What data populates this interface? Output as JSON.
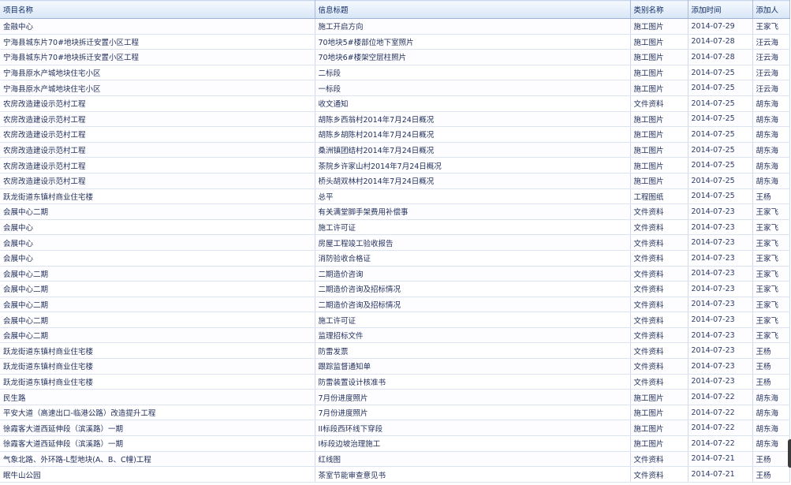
{
  "columns": [
    "项目名称",
    "信息标题",
    "类别名称",
    "添加时间",
    "添加人"
  ],
  "rows": [
    [
      "金融中心",
      "施工开启方向",
      "施工图片",
      "2014-07-29",
      "王家飞"
    ],
    [
      "宁海县城东片70#地块拆迁安置小区工程",
      "70地块5#楼部位地下室照片",
      "施工图片",
      "2014-07-28",
      "汪云海"
    ],
    [
      "宁海县城东片70#地块拆迁安置小区工程",
      "70地块6#楼架空层柱照片",
      "施工图片",
      "2014-07-28",
      "汪云海"
    ],
    [
      "宁海县原水产城地块住宅小区",
      "二标段",
      "施工图片",
      "2014-07-25",
      "汪云海"
    ],
    [
      "宁海县原水产城地块住宅小区",
      "一标段",
      "施工图片",
      "2014-07-25",
      "汪云海"
    ],
    [
      "农房改造建设示范村工程",
      "收文通知",
      "文件资料",
      "2014-07-25",
      "胡东海"
    ],
    [
      "农房改造建设示范村工程",
      "胡陈乡西翁村2014年7月24日概况",
      "施工图片",
      "2014-07-25",
      "胡东海"
    ],
    [
      "农房改造建设示范村工程",
      "胡陈乡胡陈村2014年7月24日概况",
      "施工图片",
      "2014-07-25",
      "胡东海"
    ],
    [
      "农房改造建设示范村工程",
      "桑洲镇团结村2014年7月24日概况",
      "施工图片",
      "2014-07-25",
      "胡东海"
    ],
    [
      "农房改造建设示范村工程",
      "茶院乡许家山村2014年7月24日概况",
      "施工图片",
      "2014-07-25",
      "胡东海"
    ],
    [
      "农房改造建设示范村工程",
      "桥头胡双林村2014年7月24日概况",
      "施工图片",
      "2014-07-25",
      "胡东海"
    ],
    [
      "跃龙街道东镇村商业住宅楼",
      "总平",
      "工程图纸",
      "2014-07-25",
      "王杨"
    ],
    [
      "会展中心二期",
      "有关满堂脚手架费用补偿事",
      "文件资料",
      "2014-07-23",
      "王家飞"
    ],
    [
      "会展中心",
      "施工许可证",
      "文件资料",
      "2014-07-23",
      "王家飞"
    ],
    [
      "会展中心",
      "房屋工程竣工验收报告",
      "文件资料",
      "2014-07-23",
      "王家飞"
    ],
    [
      "会展中心",
      "消防验收合格证",
      "文件资料",
      "2014-07-23",
      "王家飞"
    ],
    [
      "会展中心二期",
      "二期造价咨询",
      "文件资料",
      "2014-07-23",
      "王家飞"
    ],
    [
      "会展中心二期",
      "二期造价咨询及招标情况",
      "文件资料",
      "2014-07-23",
      "王家飞"
    ],
    [
      "会展中心二期",
      "二期造价咨询及招标情况",
      "文件资料",
      "2014-07-23",
      "王家飞"
    ],
    [
      "会展中心二期",
      "施工许可证",
      "文件资料",
      "2014-07-23",
      "王家飞"
    ],
    [
      "会展中心二期",
      "监理招标文件",
      "文件资料",
      "2014-07-23",
      "王家飞"
    ],
    [
      "跃龙街道东镇村商业住宅楼",
      "防雷发票",
      "文件资料",
      "2014-07-23",
      "王杨"
    ],
    [
      "跃龙街道东镇村商业住宅楼",
      "跟踪监督通知单",
      "文件资料",
      "2014-07-23",
      "王杨"
    ],
    [
      "跃龙街道东镇村商业住宅楼",
      "防雷装置设计核准书",
      "文件资料",
      "2014-07-23",
      "王杨"
    ],
    [
      "民生路",
      "7月份进度照片",
      "施工图片",
      "2014-07-22",
      "胡东海"
    ],
    [
      "平安大道（高速出口-临港公路）改造提升工程",
      "7月份进度照片",
      "施工图片",
      "2014-07-22",
      "胡东海"
    ],
    [
      "徐霞客大道西延伸段（滨溪路）一期",
      "II标段西环线下穿段",
      "施工图片",
      "2014-07-22",
      "胡东海"
    ],
    [
      "徐霞客大道西延伸段（滨溪路）一期",
      "I标段边坡治理施工",
      "施工图片",
      "2014-07-22",
      "胡东海"
    ],
    [
      "气象北路、外环路-L型地块(A、B、C幢)工程",
      "红线图",
      "文件资料",
      "2014-07-21",
      "王杨"
    ],
    [
      "眠牛山公园",
      "茶室节能审查意见书",
      "文件资料",
      "2014-07-21",
      "王杨"
    ]
  ]
}
